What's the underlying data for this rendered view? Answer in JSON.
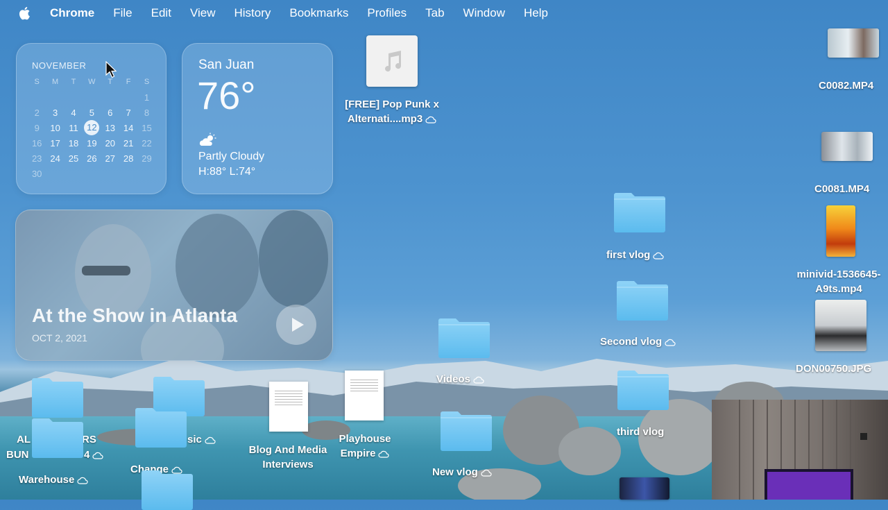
{
  "menubar": {
    "apple_icon": "apple-icon",
    "app_name": "Chrome",
    "items": [
      "File",
      "Edit",
      "View",
      "History",
      "Bookmarks",
      "Profiles",
      "Tab",
      "Window",
      "Help"
    ]
  },
  "calendar": {
    "month": "NOVEMBER",
    "weekdays": [
      "S",
      "M",
      "T",
      "W",
      "T",
      "F",
      "S"
    ],
    "today": "12",
    "weeks": [
      [
        "",
        "",
        "",
        "",
        "",
        "",
        "1"
      ],
      [
        "2",
        "3",
        "4",
        "5",
        "6",
        "7",
        "8"
      ],
      [
        "9",
        "10",
        "11",
        "12",
        "13",
        "14",
        "15"
      ],
      [
        "16",
        "17",
        "18",
        "19",
        "20",
        "21",
        "22"
      ],
      [
        "23",
        "24",
        "25",
        "26",
        "27",
        "28",
        "29"
      ],
      [
        "30",
        "",
        "",
        "",
        "",
        "",
        ""
      ]
    ]
  },
  "weather": {
    "city": "San Juan",
    "temp": "76°",
    "condition": "Partly Cloudy",
    "high_low": "H:88° L:74°",
    "icon": "partly-cloudy-icon"
  },
  "photos": {
    "title": "At the Show in Atlanta",
    "date": "OCT 2, 2021",
    "play_icon": "play-icon"
  },
  "desktop": {
    "mp3": {
      "line1": "[FREE] Pop Punk x",
      "line2": "Alternati....mp3"
    },
    "c0082": "C0082.MP4",
    "c0081": "C0081.MP4",
    "minivid": {
      "line1": "minivid-1536645-",
      "line2": "A9ts.mp4"
    },
    "don": "DON00750.JPG",
    "first_vlog": "first vlog",
    "second_vlog": "Second vlog",
    "third_vlog": "third vlog",
    "videos": "Videos",
    "new_vlog": "New vlog",
    "blog": {
      "line1": "Blog And Media",
      "line2": "Interviews"
    },
    "playhouse": {
      "line1": "Playhouse",
      "line2": "Empire"
    },
    "warehouse": "Warehouse",
    "all_covered": {
      "line1": "AL",
      "line1b": "RS",
      "line2": "BUN",
      "line2b": "4"
    },
    "music_partial": "sic",
    "change_partial": "Change"
  },
  "colors": {
    "folder_light": "#8fd3f7",
    "folder_dark": "#5bbbee",
    "accent": "#4a8cc7"
  }
}
